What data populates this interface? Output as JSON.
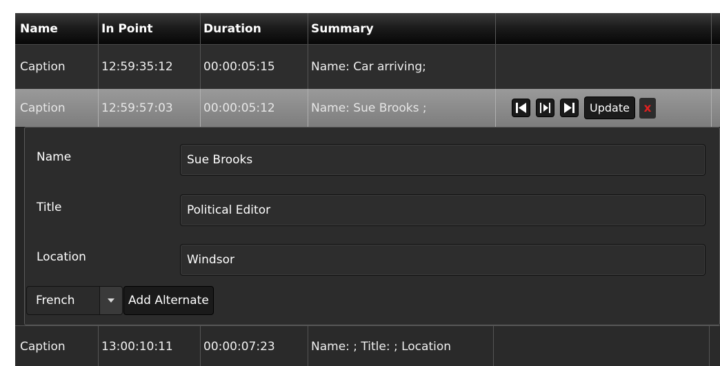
{
  "table": {
    "columns": [
      "Name",
      "In Point",
      "Duration",
      "Summary",
      ""
    ],
    "rows": [
      {
        "name": "Caption",
        "in_point": "12:59:35:12",
        "duration": "00:00:05:15",
        "summary": "Name: Car arriving;"
      },
      {
        "name": "Caption",
        "in_point": "12:59:57:03",
        "duration": "00:00:05:12",
        "summary": "Name: Sue Brooks ;"
      },
      {
        "name": "Caption",
        "in_point": "13:00:10:11",
        "duration": "00:00:07:23",
        "summary": "Name: ; Title: ; Location"
      }
    ]
  },
  "row_actions": {
    "icons": [
      "skip-to-start-icon",
      "step-icon",
      "skip-to-end-icon"
    ],
    "update_label": "Update",
    "delete_label": "x",
    "delete_color": "#e02020"
  },
  "editor": {
    "fields": [
      {
        "label": "Name",
        "value": "Sue Brooks"
      },
      {
        "label": "Title",
        "value": "Political Editor"
      },
      {
        "label": "Location",
        "value": "Windsor"
      }
    ],
    "language": "French",
    "add_alternate_label": "Add Alternate"
  }
}
